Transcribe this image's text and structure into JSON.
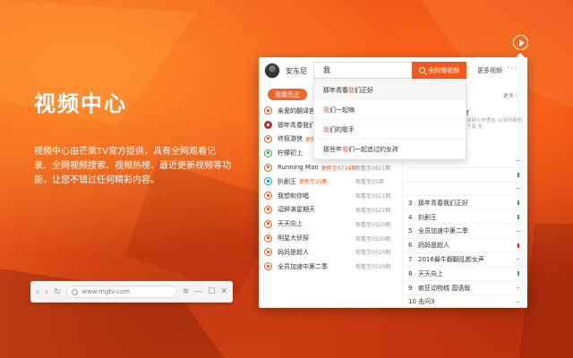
{
  "hero": {
    "title": "视频中心",
    "description": "视频中心由芒果TV官方提供，具有全网观看记录、全网视频搜索、视频热榜、最近更新视频等功能，让您不错过任何精彩内容。"
  },
  "browser": {
    "url": "www.mgtv.com",
    "back": "‹",
    "forward": "›",
    "reload": "↻",
    "menu": "≡",
    "minimize": "—",
    "maximize": "☐",
    "close": "✕"
  },
  "panel": {
    "username": "安东尼",
    "more_videos": "更多视频",
    "more_dots": "···",
    "history_tab": "观看历史",
    "history": [
      {
        "title": "亲爱的翻译官",
        "note": "",
        "progress": "",
        "icon": "orange"
      },
      {
        "title": "那年青春我们",
        "note": "",
        "progress": "",
        "icon": "red"
      },
      {
        "title": "终极游侠",
        "note": "更新",
        "progress": "",
        "icon": "orange"
      },
      {
        "title": "柠檬初上",
        "note": "",
        "progress": "",
        "icon": "green"
      },
      {
        "title": "Running Man",
        "note": "更新至0714期",
        "progress": "观看至0621期",
        "icon": "orange"
      },
      {
        "title": "扒剧王",
        "note": "更新至25集",
        "progress": "观看至05期",
        "icon": "blue"
      },
      {
        "title": "我想和你唱",
        "note": "",
        "progress": "观看至0521期",
        "icon": "orange"
      },
      {
        "title": "逗鲜演星期天",
        "note": "",
        "progress": "观看至0522期",
        "icon": "orange"
      },
      {
        "title": "天天向上",
        "note": "",
        "progress": "观看至0520期",
        "icon": "orange"
      },
      {
        "title": "明星大侦探",
        "note": "",
        "progress": "观看至0520期",
        "icon": "orange"
      },
      {
        "title": "妈妈是超人",
        "note": "",
        "progress": "观看至0520期",
        "icon": "orange"
      },
      {
        "title": "全员加速中第二季",
        "note": "",
        "progress": "观看至0520期",
        "icon": "orange"
      }
    ],
    "rank_more": "更多 ›",
    "featured_title": "蜂官",
    "featured_sub": "法课谈硕士亦吾在 以法刑新的海华下底 化",
    "rankings": [
      {
        "num": "",
        "title": "",
        "trend": "flat"
      },
      {
        "num": "",
        "title": "",
        "trend": "down"
      },
      {
        "num": "",
        "title": "",
        "trend": "flat"
      },
      {
        "num": "3",
        "title": "那年青春我们正好",
        "trend": "down"
      },
      {
        "num": "4",
        "title": "扒剧王",
        "trend": "down"
      },
      {
        "num": "5",
        "title": "全员加速中第二季",
        "trend": "flat"
      },
      {
        "num": "6",
        "title": "妈妈是超人",
        "trend": "up"
      },
      {
        "num": "7",
        "title": "2016最牛翻翻乱颜女声",
        "trend": "flat"
      },
      {
        "num": "8",
        "title": "天天向上",
        "trend": "down"
      },
      {
        "num": "9",
        "title": "疯狂动物城 国语版",
        "trend": "flat"
      },
      {
        "num": "10",
        "title": "击问3",
        "trend": "flat"
      }
    ]
  },
  "search": {
    "query": "我",
    "button": "全网搜视频",
    "suggestions": [
      {
        "pre": "那年青春",
        "hl": "我",
        "post": "们正好"
      },
      {
        "pre": "",
        "hl": "我",
        "post": "们一起嗨"
      },
      {
        "pre": "",
        "hl": "我",
        "post": "们的歌手"
      },
      {
        "pre": "那些年",
        "hl": "我",
        "post": "们一起追过的女孩"
      }
    ]
  },
  "colors": {
    "accent": "#f15a1c",
    "up": "#e02020",
    "down": "#2ea84a"
  }
}
